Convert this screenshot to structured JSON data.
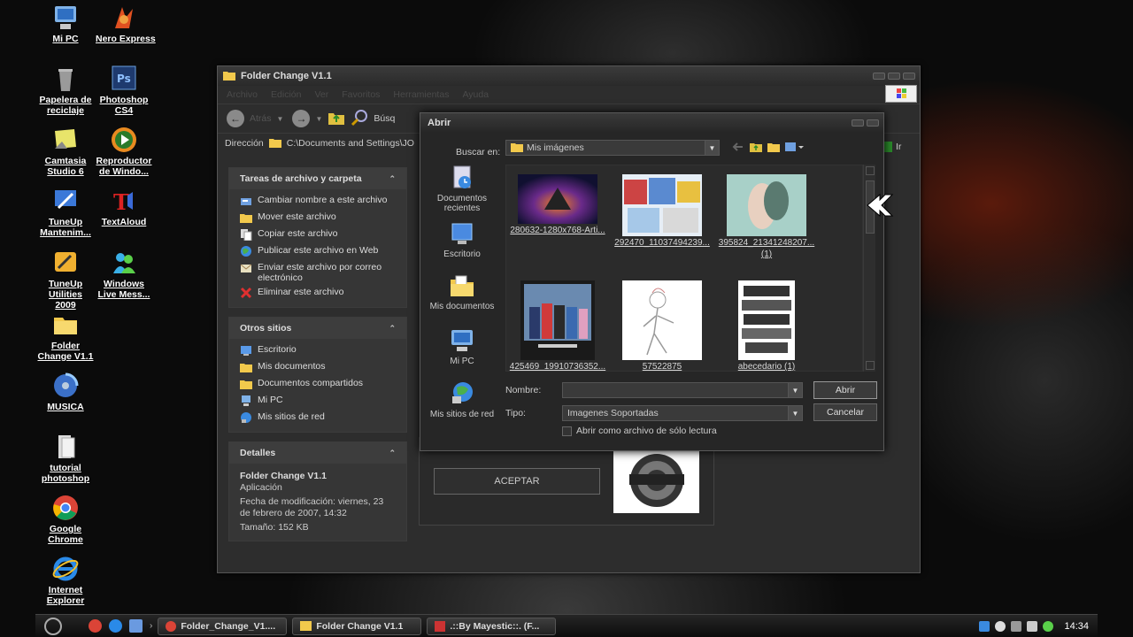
{
  "desktop": {
    "icons": [
      {
        "label": "Mi PC"
      },
      {
        "label": "Nero Express"
      },
      {
        "label": "Papelera de reciclaje"
      },
      {
        "label": "Photoshop CS4"
      },
      {
        "label": "Camtasia Studio 6"
      },
      {
        "label": "Reproductor de Windo..."
      },
      {
        "label": "TuneUp Mantenim..."
      },
      {
        "label": "TextAloud"
      },
      {
        "label": "TuneUp Utilities 2009"
      },
      {
        "label": "Windows Live Mess..."
      },
      {
        "label": "Folder Change V1.1"
      },
      {
        "label": "MUSICA"
      },
      {
        "label": "tutorial photoshop"
      },
      {
        "label": "Google Chrome"
      },
      {
        "label": "Internet Explorer"
      }
    ]
  },
  "explorer": {
    "title": "Folder Change V1.1",
    "menu": [
      "Archivo",
      "Edición",
      "Ver",
      "Favoritos",
      "Herramientas",
      "Ayuda"
    ],
    "toolbar": {
      "back": "Atrás",
      "search": "Búsq"
    },
    "address": {
      "label": "Dirección",
      "value": "C:\\Documents and Settings\\JO",
      "go": "Ir"
    },
    "tasks": {
      "title": "Tareas de archivo y carpeta",
      "items": [
        "Cambiar nombre a este archivo",
        "Mover este archivo",
        "Copiar este archivo",
        "Publicar este archivo en Web",
        "Enviar este archivo por correo electrónico",
        "Eliminar este archivo"
      ]
    },
    "other": {
      "title": "Otros sitios",
      "items": [
        "Escritorio",
        "Mis documentos",
        "Documentos compartidos",
        "Mi PC",
        "Mis sitios de red"
      ]
    },
    "details": {
      "title": "Detalles",
      "name": "Folder Change V1.1",
      "type": "Aplicación",
      "modified": "Fecha de modificación: viernes, 23 de febrero de 2007, 14:32",
      "size": "Tamaño: 152 KB"
    },
    "accept_button": "ACEPTAR"
  },
  "dialog": {
    "title": "Abrir",
    "look_in_label": "Buscar en:",
    "look_in_value": "Mis imágenes",
    "places": [
      "Documentos recientes",
      "Escritorio",
      "Mis documentos",
      "Mi PC",
      "Mis sitios de red"
    ],
    "files": [
      {
        "name": "280632-1280x768-Arti..."
      },
      {
        "name": "292470_11037494239..."
      },
      {
        "name": "395824_21341248207...",
        "name2": "(1)"
      },
      {
        "name": "425469_19910736352..."
      },
      {
        "name": "57522875"
      },
      {
        "name": "abecedario (1)"
      }
    ],
    "name_label": "Nombre:",
    "name_value": "",
    "type_label": "Tipo:",
    "type_value": "Imagenes Soportadas",
    "readonly_label": "Abrir como archivo de sólo lectura",
    "open_button": "Abrir",
    "cancel_button": "Cancelar"
  },
  "taskbar": {
    "buttons": [
      "Folder_Change_V1....",
      "Folder Change V1.1",
      ".::By Mayestic::. (F..."
    ],
    "clock": "14:34"
  }
}
